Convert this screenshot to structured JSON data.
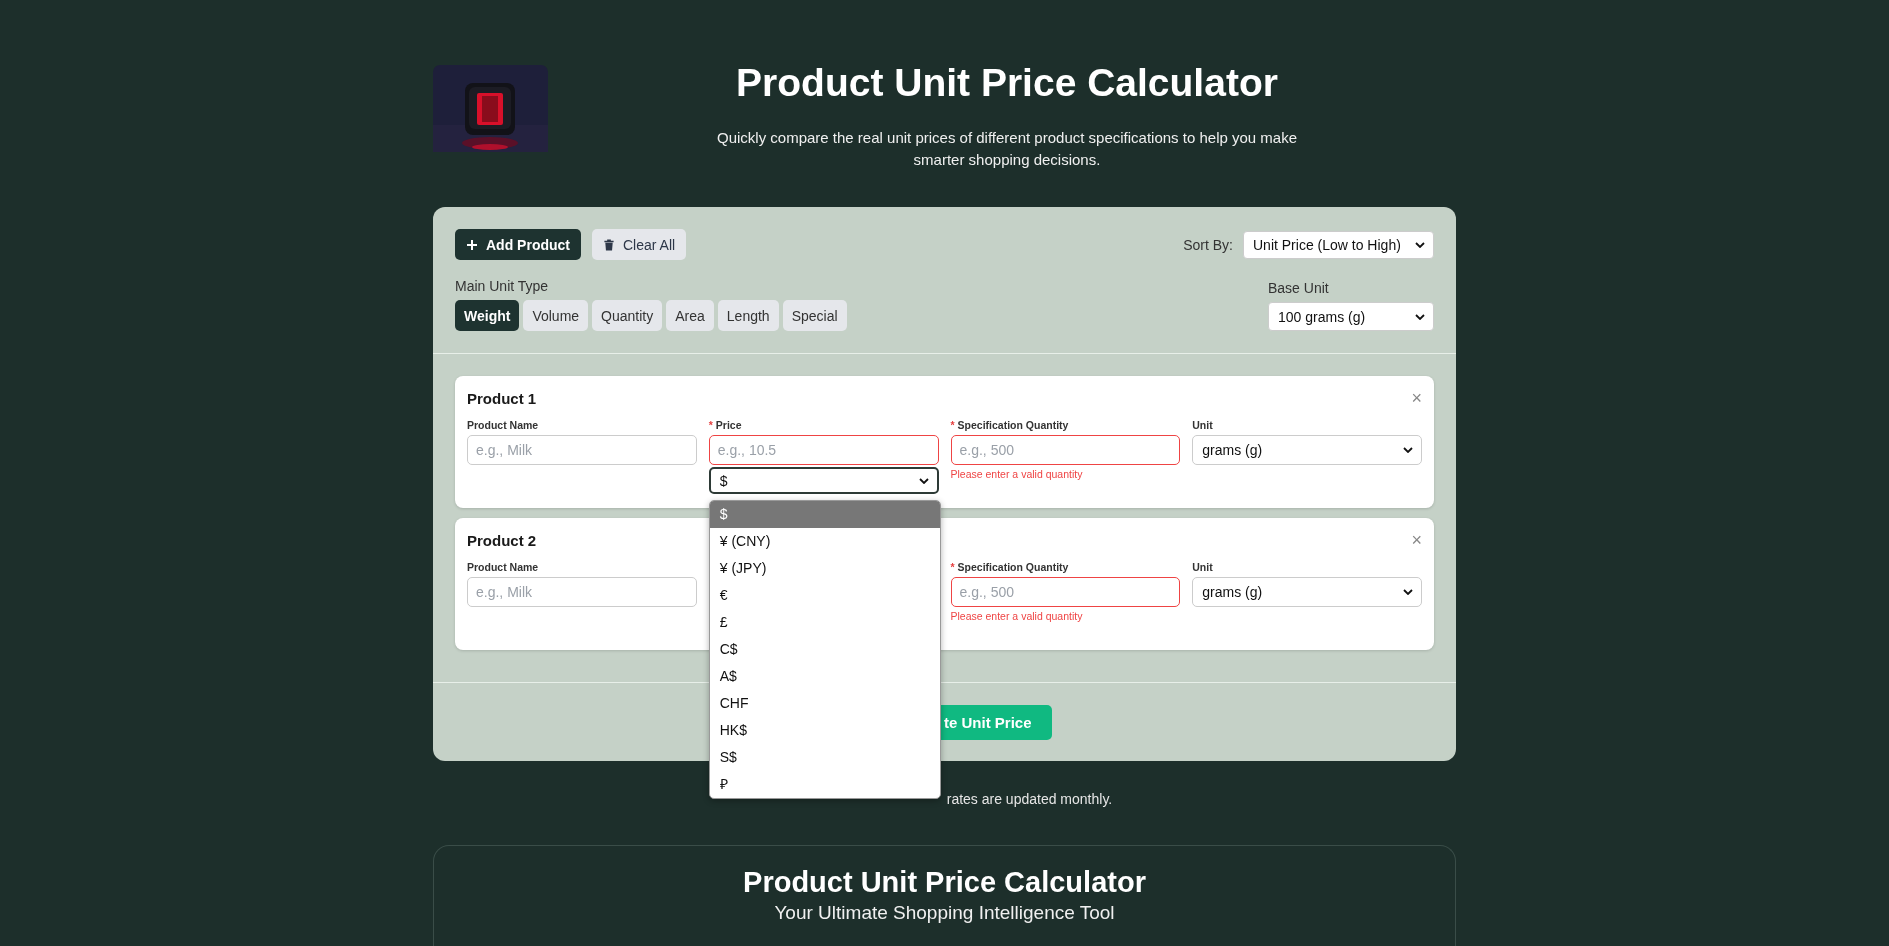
{
  "header": {
    "title": "Product Unit Price Calculator",
    "subtitle": "Quickly compare the real unit prices of different product specifications to help you make smarter shopping decisions."
  },
  "toolbar": {
    "buttons": [
      {
        "label": "Add Product",
        "kind": "primary"
      },
      {
        "label": "Clear All",
        "kind": "secondary"
      }
    ],
    "sort": {
      "label": "Sort By:",
      "value": "Unit Price (Low to High)"
    }
  },
  "unit_type": {
    "label": "Main Unit Type",
    "tabs": [
      {
        "label": "Weight",
        "selected": true
      },
      {
        "label": "Volume",
        "selected": false
      },
      {
        "label": "Quantity",
        "selected": false
      },
      {
        "label": "Area",
        "selected": false
      },
      {
        "label": "Length",
        "selected": false
      },
      {
        "label": "Special",
        "selected": false
      }
    ]
  },
  "base_unit": {
    "label": "Base Unit",
    "value": "100 grams (g)"
  },
  "products": [
    {
      "title": "Product 1",
      "close": "×",
      "fields": [
        {
          "kind": "name",
          "label": "Product Name",
          "placeholder": "e.g., Milk",
          "invalid": false
        },
        {
          "kind": "price",
          "label": "Price",
          "required_mark": "*",
          "placeholder": "e.g., 10.5",
          "invalid": true
        },
        {
          "kind": "quantity",
          "label": "Specification Quantity",
          "required_mark": "*",
          "placeholder": "e.g., 500",
          "invalid": true,
          "error": "Please enter a valid quantity"
        },
        {
          "kind": "unit",
          "label": "Unit",
          "value": "grams (g)"
        }
      ],
      "currency": {
        "value": "$",
        "open": true,
        "options": [
          {
            "label": "$",
            "selected": true
          },
          {
            "label": "¥ (CNY)",
            "selected": false
          },
          {
            "label": "¥ (JPY)",
            "selected": false
          },
          {
            "label": "€",
            "selected": false
          },
          {
            "label": "£",
            "selected": false
          },
          {
            "label": "C$",
            "selected": false
          },
          {
            "label": "A$",
            "selected": false
          },
          {
            "label": "CHF",
            "selected": false
          },
          {
            "label": "HK$",
            "selected": false
          },
          {
            "label": "S$",
            "selected": false
          },
          {
            "label": "₽",
            "selected": false
          }
        ]
      }
    },
    {
      "title": "Product 2",
      "close": "×",
      "fields": [
        {
          "kind": "name",
          "label": "Product Name",
          "placeholder": "e.g., Milk",
          "invalid": false
        },
        {
          "kind": "quantity",
          "label": "Specification Quantity",
          "required_mark": "*",
          "placeholder": "e.g., 500",
          "invalid": true,
          "error": "Please enter a valid quantity"
        },
        {
          "kind": "unit",
          "label": "Unit",
          "value": "grams (g)"
        }
      ]
    }
  ],
  "calculate_button": {
    "label": "te Unit Price"
  },
  "footnote": "rates are updated monthly.",
  "about": {
    "title": "Product Unit Price Calculator",
    "subtitle": "Your Ultimate Shopping Intelligence Tool"
  }
}
